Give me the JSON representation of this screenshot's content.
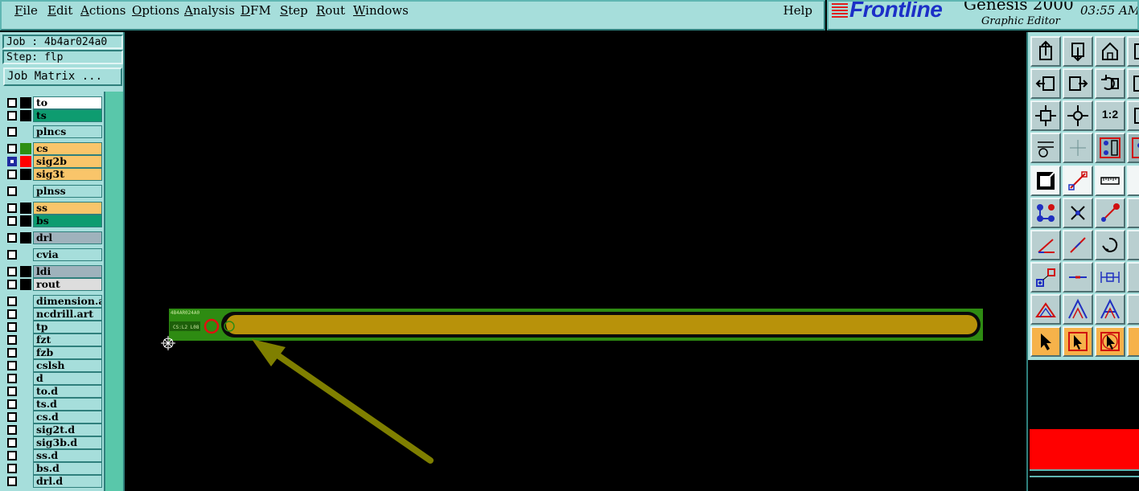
{
  "menubar": {
    "items": [
      "File",
      "Edit",
      "Actions",
      "Options",
      "Analysis",
      "DFM",
      "Step",
      "Rout",
      "Windows"
    ],
    "help": "Help"
  },
  "brand": {
    "logo": "Frontline",
    "product": "Genesis 2000",
    "subtitle": "Graphic Editor",
    "clock": "03:55 AM"
  },
  "job": {
    "job_label": "Job : 4b4ar024a0",
    "step_label": "Step: flp",
    "matrix_button": "Job Matrix ..."
  },
  "layers": [
    {
      "name": "to",
      "color": "#ffffff",
      "swatch": "#000000",
      "checked": false
    },
    {
      "name": "ts",
      "color": "#0e9c70",
      "swatch": "#000000",
      "checked": false
    },
    {
      "name": "plncs",
      "color": "#a6dedb",
      "swatch": "#a6dedb",
      "checked": false
    },
    {
      "name": "cs",
      "color": "#f9c56a",
      "swatch": "#2d8f12",
      "checked": false
    },
    {
      "name": "sig2b",
      "color": "#f9c56a",
      "swatch": "#ff0000",
      "checked": true
    },
    {
      "name": "sig3t",
      "color": "#f9c56a",
      "swatch": "#000000",
      "checked": false
    },
    {
      "name": "plnss",
      "color": "#a6dedb",
      "swatch": "#a6dedb",
      "checked": false
    },
    {
      "name": "ss",
      "color": "#f9c56a",
      "swatch": "#000000",
      "checked": false
    },
    {
      "name": "bs",
      "color": "#0e9c70",
      "swatch": "#000000",
      "checked": false
    },
    {
      "name": "drl",
      "color": "#9fb2bc",
      "swatch": "#000000",
      "checked": false
    },
    {
      "name": "cvia",
      "color": "#a6dedb",
      "swatch": "#a6dedb",
      "checked": false
    },
    {
      "name": "ldi",
      "color": "#9fb2bc",
      "swatch": "#000000",
      "checked": false
    },
    {
      "name": "rout",
      "color": "#dddddd",
      "swatch": "#000000",
      "checked": false
    },
    {
      "name": "dimension.art",
      "color": "#a6dedb",
      "swatch": "#a6dedb",
      "checked": false
    },
    {
      "name": "ncdrill.art",
      "color": "#a6dedb",
      "swatch": "#a6dedb",
      "checked": false
    },
    {
      "name": "tp",
      "color": "#a6dedb",
      "swatch": "#a6dedb",
      "checked": false
    },
    {
      "name": "fzt",
      "color": "#a6dedb",
      "swatch": "#a6dedb",
      "checked": false
    },
    {
      "name": "fzb",
      "color": "#a6dedb",
      "swatch": "#a6dedb",
      "checked": false
    },
    {
      "name": "cslsh",
      "color": "#a6dedb",
      "swatch": "#a6dedb",
      "checked": false
    },
    {
      "name": "d",
      "color": "#a6dedb",
      "swatch": "#a6dedb",
      "checked": false
    },
    {
      "name": "to.d",
      "color": "#a6dedb",
      "swatch": "#a6dedb",
      "checked": false
    },
    {
      "name": "ts.d",
      "color": "#a6dedb",
      "swatch": "#a6dedb",
      "checked": false
    },
    {
      "name": "cs.d",
      "color": "#a6dedb",
      "swatch": "#a6dedb",
      "checked": false
    },
    {
      "name": "sig2t.d",
      "color": "#a6dedb",
      "swatch": "#a6dedb",
      "checked": false
    },
    {
      "name": "sig3b.d",
      "color": "#a6dedb",
      "swatch": "#a6dedb",
      "checked": false
    },
    {
      "name": "ss.d",
      "color": "#a6dedb",
      "swatch": "#a6dedb",
      "checked": false
    },
    {
      "name": "bs.d",
      "color": "#a6dedb",
      "swatch": "#a6dedb",
      "checked": false
    },
    {
      "name": "drl.d",
      "color": "#a6dedb",
      "swatch": "#a6dedb",
      "checked": false
    }
  ],
  "canvas": {
    "board_text_top": "4B4AR024A0",
    "board_text_bottom": "CS:L2 L08",
    "arrow_color": "#7f7f00",
    "board_green": "#2e8b12",
    "board_gold": "#b8920a"
  },
  "toolbar": {
    "buttons": [
      {
        "icon": "open-job-icon",
        "style": "normal"
      },
      {
        "icon": "save-job-icon",
        "style": "normal"
      },
      {
        "icon": "home-icon",
        "style": "normal"
      },
      {
        "icon": "window-icon",
        "style": "normal"
      },
      {
        "icon": "pan-left-icon",
        "style": "normal"
      },
      {
        "icon": "pan-right-icon",
        "style": "normal"
      },
      {
        "icon": "undo-icon",
        "style": "normal"
      },
      {
        "icon": "zoom-icon",
        "style": "normal"
      },
      {
        "icon": "fit-icon",
        "style": "normal"
      },
      {
        "icon": "center-icon",
        "style": "normal"
      },
      {
        "icon": "scale-icon",
        "style": "normal",
        "text": "1:2"
      },
      {
        "icon": "frame-icon",
        "style": "normal"
      },
      {
        "icon": "snap-icon",
        "style": "normal"
      },
      {
        "icon": "grid-icon",
        "style": "normal"
      },
      {
        "icon": "net-icon",
        "style": "dark"
      },
      {
        "icon": "net2-icon",
        "style": "dark"
      },
      {
        "icon": "select-box-icon",
        "style": "white"
      },
      {
        "icon": "measure-icon",
        "style": "white"
      },
      {
        "icon": "ruler-icon",
        "style": "white"
      },
      {
        "icon": "circle-icon",
        "style": "white"
      },
      {
        "icon": "connect-icon",
        "style": "normal"
      },
      {
        "icon": "cross-icon",
        "style": "normal"
      },
      {
        "icon": "line-icon",
        "style": "normal"
      },
      {
        "icon": "dot-icon",
        "style": "normal"
      },
      {
        "icon": "angle-icon",
        "style": "normal"
      },
      {
        "icon": "slope-icon",
        "style": "normal"
      },
      {
        "icon": "rotate-icon",
        "style": "normal"
      },
      {
        "icon": "bracket-icon",
        "style": "normal"
      },
      {
        "icon": "pad-icon",
        "style": "normal"
      },
      {
        "icon": "minus-icon",
        "style": "normal"
      },
      {
        "icon": "span-icon",
        "style": "normal"
      },
      {
        "icon": "node-icon",
        "style": "normal"
      },
      {
        "icon": "triangle-icon",
        "style": "normal"
      },
      {
        "icon": "triangle-up-icon",
        "style": "normal"
      },
      {
        "icon": "letter-a-icon",
        "style": "normal"
      },
      {
        "icon": "letter-a2-icon",
        "style": "normal"
      },
      {
        "icon": "pointer-icon",
        "style": "orange"
      },
      {
        "icon": "pointer-box-icon",
        "style": "orange"
      },
      {
        "icon": "pointer-circle-icon",
        "style": "orange"
      },
      {
        "icon": "pointer-net-icon",
        "style": "orange"
      }
    ]
  }
}
